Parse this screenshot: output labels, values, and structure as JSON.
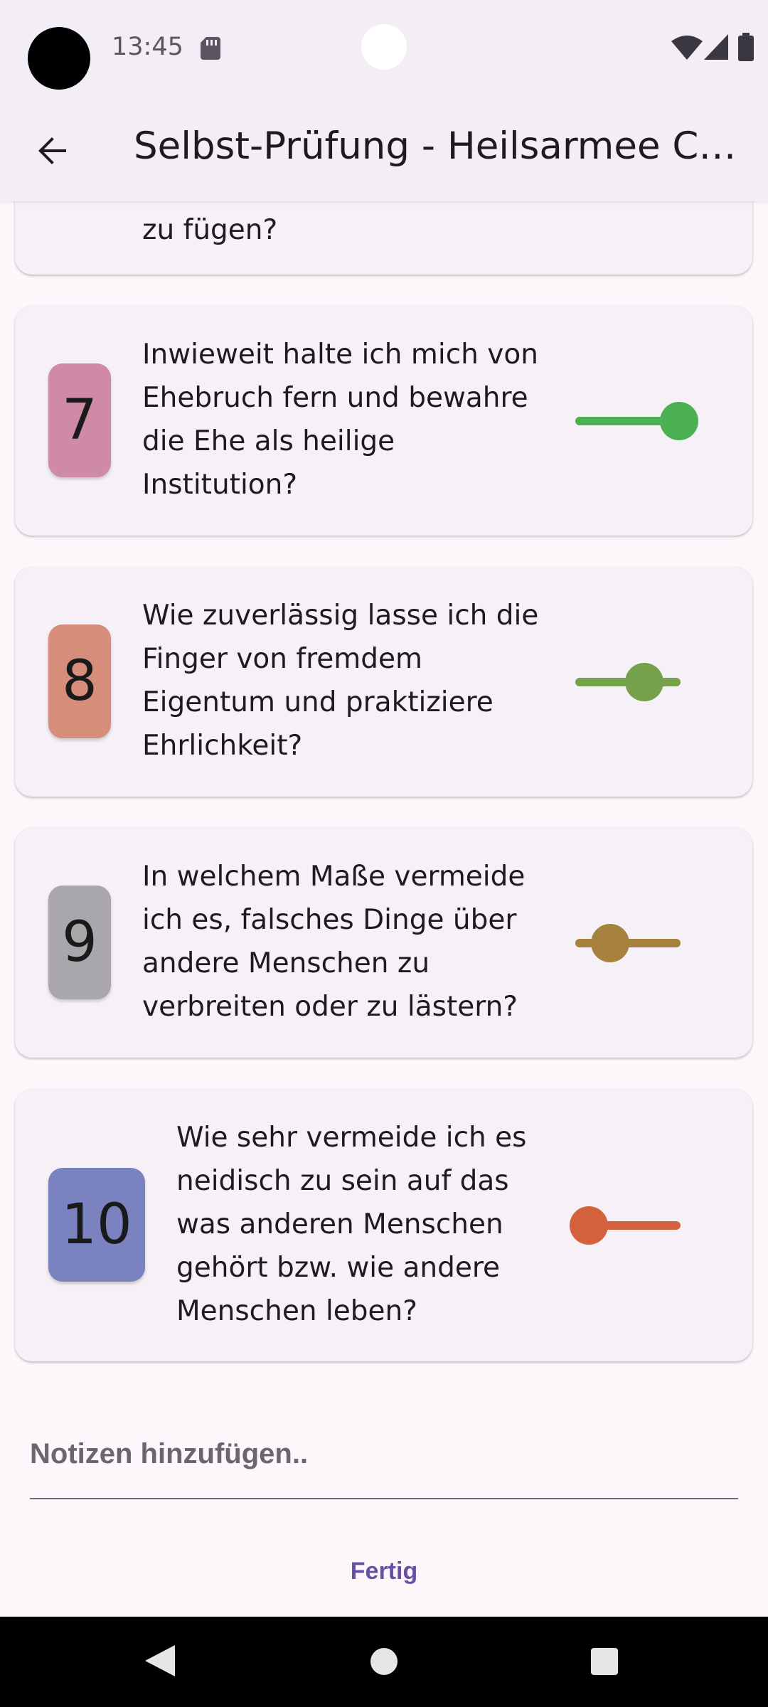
{
  "status_bar": {
    "time": "13:45",
    "icons": [
      "sd-card-icon",
      "wifi-icon",
      "signal-icon",
      "battery-icon"
    ]
  },
  "app_bar": {
    "back_icon": "arrow-back-icon",
    "title": "Selbst-Prüfung - Heilsarmee Ch…"
  },
  "questions": [
    {
      "number": "",
      "text": "zu fügen?",
      "partial": true
    },
    {
      "number": "7",
      "text": "Inwieweit halte ich mich von Ehebruch fern und bewahre die Ehe als heilige Institution?",
      "badge_color": "#cf8aa5",
      "slider_color": "#4cb152",
      "slider_value": 1.0
    },
    {
      "number": "8",
      "text": "Wie zuverlässig lasse ich die Finger von fremdem Eigentum und praktiziere Ehrlichkeit?",
      "badge_color": "#d68e7b",
      "slider_color": "#74a14a",
      "slider_value": 0.67
    },
    {
      "number": "9",
      "text": "In welchem Maße vermeide ich es, falsches Dinge über andere Menschen zu verbreiten oder zu lästern?",
      "badge_color": "#a9a6ac",
      "slider_color": "#a7823f",
      "slider_value": 0.33
    },
    {
      "number": "10",
      "text": "Wie sehr vermeide ich es neidisch zu sein auf das was anderen Menschen gehört bzw. wie andere Menschen leben?",
      "badge_color": "#7a82bf",
      "slider_color": "#d2613c",
      "slider_value": 0.0
    }
  ],
  "notes": {
    "placeholder": "Notizen hinzufügen.."
  },
  "actions": {
    "done_label": "Fertig"
  },
  "colors": {
    "accent": "#6750a4",
    "surface": "#fdf7fc",
    "card": "#f6f1f6"
  },
  "nav_bar": {
    "icons": [
      "nav-back-icon",
      "nav-home-icon",
      "nav-recents-icon"
    ]
  }
}
